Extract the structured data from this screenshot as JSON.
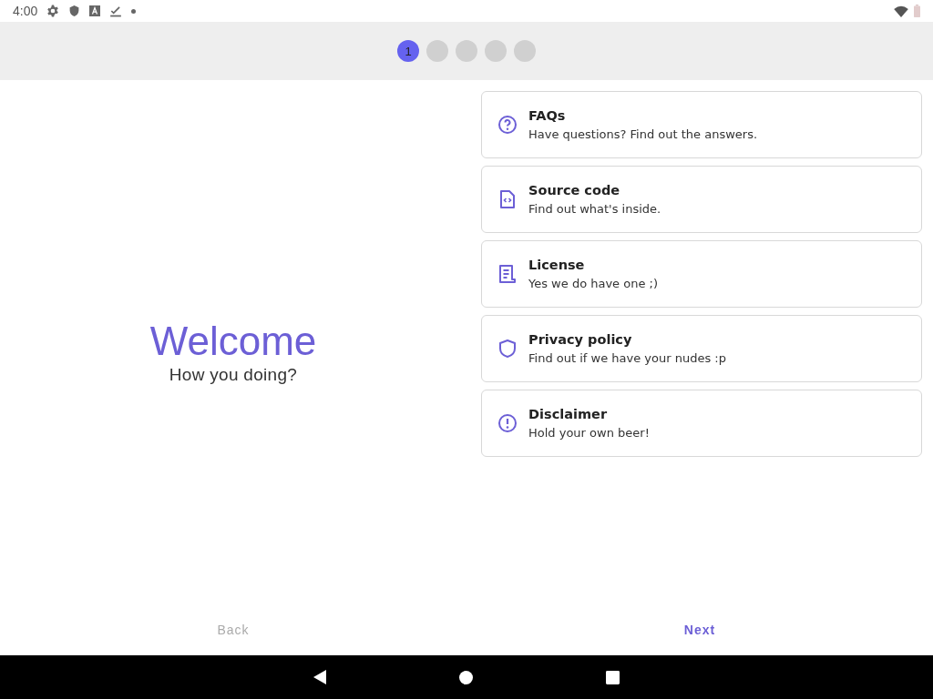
{
  "status_bar": {
    "time": "4:00"
  },
  "stepper": [
    {
      "label": "1",
      "selected": true
    },
    {
      "selected": false
    },
    {
      "selected": false
    },
    {
      "selected": false
    },
    {
      "selected": false
    }
  ],
  "welcome": {
    "title": "Welcome",
    "subtitle": "How you doing?"
  },
  "cards": [
    {
      "kind": "faq",
      "title": "FAQs",
      "subtitle": "Have questions? Find out the answers."
    },
    {
      "kind": "source",
      "title": "Source code",
      "subtitle": "Find out what's inside."
    },
    {
      "kind": "license",
      "title": "License",
      "subtitle": "Yes we do have one ;)"
    },
    {
      "kind": "privacy",
      "title": "Privacy policy",
      "subtitle": "Find out if we have your nudes :p"
    },
    {
      "kind": "disclaimer",
      "title": "Disclaimer",
      "subtitle": "Hold your own beer!"
    }
  ],
  "buttons": [
    {
      "label": "Back",
      "disabled": true
    },
    {
      "label": "Next",
      "disabled": false
    }
  ]
}
